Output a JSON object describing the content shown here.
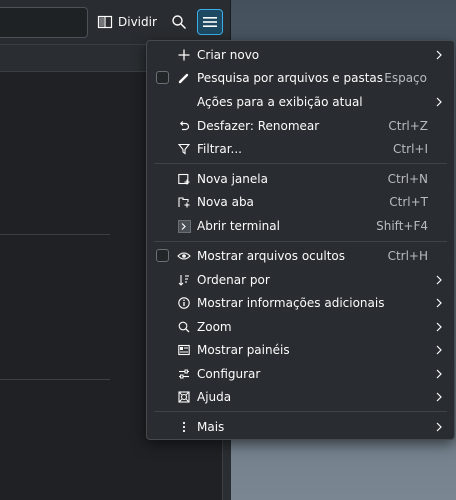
{
  "toolbar": {
    "split_label": "Dividir",
    "icons": {
      "split": "split-view-icon",
      "search": "search-icon",
      "menu": "hamburger-menu-icon"
    }
  },
  "menu": {
    "items": [
      {
        "label": "Criar novo",
        "shortcut": "",
        "icon": "plus-icon",
        "submenu": true,
        "checkbox": false
      },
      {
        "label": "Pesquisa por arquivos e pastas",
        "shortcut": "Espaço",
        "icon": "pencil-search-icon",
        "submenu": false,
        "checkbox": true
      },
      {
        "label": "Ações para a exibição atual",
        "shortcut": "",
        "icon": "",
        "submenu": true,
        "checkbox": false
      },
      {
        "label": "Desfazer: Renomear",
        "shortcut": "Ctrl+Z",
        "icon": "undo-icon",
        "submenu": false,
        "checkbox": false
      },
      {
        "label": "Filtrar...",
        "shortcut": "Ctrl+I",
        "icon": "filter-icon",
        "submenu": false,
        "checkbox": false
      },
      {
        "label": "Nova janela",
        "shortcut": "Ctrl+N",
        "icon": "new-window-icon",
        "submenu": false,
        "checkbox": false
      },
      {
        "label": "Nova aba",
        "shortcut": "Ctrl+T",
        "icon": "new-tab-icon",
        "submenu": false,
        "checkbox": false
      },
      {
        "label": "Abrir terminal",
        "shortcut": "Shift+F4",
        "icon": "terminal-icon",
        "submenu": false,
        "checkbox": false
      },
      {
        "label": "Mostrar arquivos ocultos",
        "shortcut": "Ctrl+H",
        "icon": "eye-icon",
        "submenu": false,
        "checkbox": true
      },
      {
        "label": "Ordenar por",
        "shortcut": "",
        "icon": "sort-icon",
        "submenu": true,
        "checkbox": false
      },
      {
        "label": "Mostrar informações adicionais",
        "shortcut": "",
        "icon": "info-icon",
        "submenu": true,
        "checkbox": false
      },
      {
        "label": "Zoom",
        "shortcut": "",
        "icon": "zoom-icon",
        "submenu": true,
        "checkbox": false
      },
      {
        "label": "Mostrar painéis",
        "shortcut": "",
        "icon": "panels-icon",
        "submenu": true,
        "checkbox": false
      },
      {
        "label": "Configurar",
        "shortcut": "",
        "icon": "configure-icon",
        "submenu": true,
        "checkbox": false
      },
      {
        "label": "Ajuda",
        "shortcut": "",
        "icon": "help-icon",
        "submenu": true,
        "checkbox": false
      },
      {
        "label": "Mais",
        "shortcut": "",
        "icon": "more-vertical-icon",
        "submenu": true,
        "checkbox": false
      }
    ]
  },
  "colors": {
    "accent": "#3daee9",
    "menu_bg": "#292c30",
    "text": "#fcfcfc",
    "shortcut": "#b8bcc0"
  }
}
